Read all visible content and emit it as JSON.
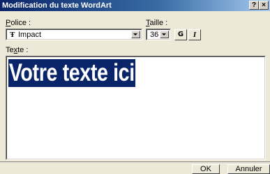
{
  "window": {
    "title": "Modification du texte WordArt",
    "help_label": "?",
    "close_label": "×"
  },
  "font": {
    "label_u": "P",
    "label_rest": "olice :",
    "icon": "Ŧ",
    "value": "Impact"
  },
  "size": {
    "label_u": "T",
    "label_rest": "aille :",
    "value": "36"
  },
  "style_buttons": {
    "bold_label": "G",
    "italic_label": "I"
  },
  "text": {
    "label_pre": "Te",
    "label_u": "x",
    "label_rest": "te :",
    "value": "Votre texte ici",
    "selection_color": "#0a246a"
  },
  "footer": {
    "ok_label": "OK",
    "cancel_label": "Annuler"
  }
}
